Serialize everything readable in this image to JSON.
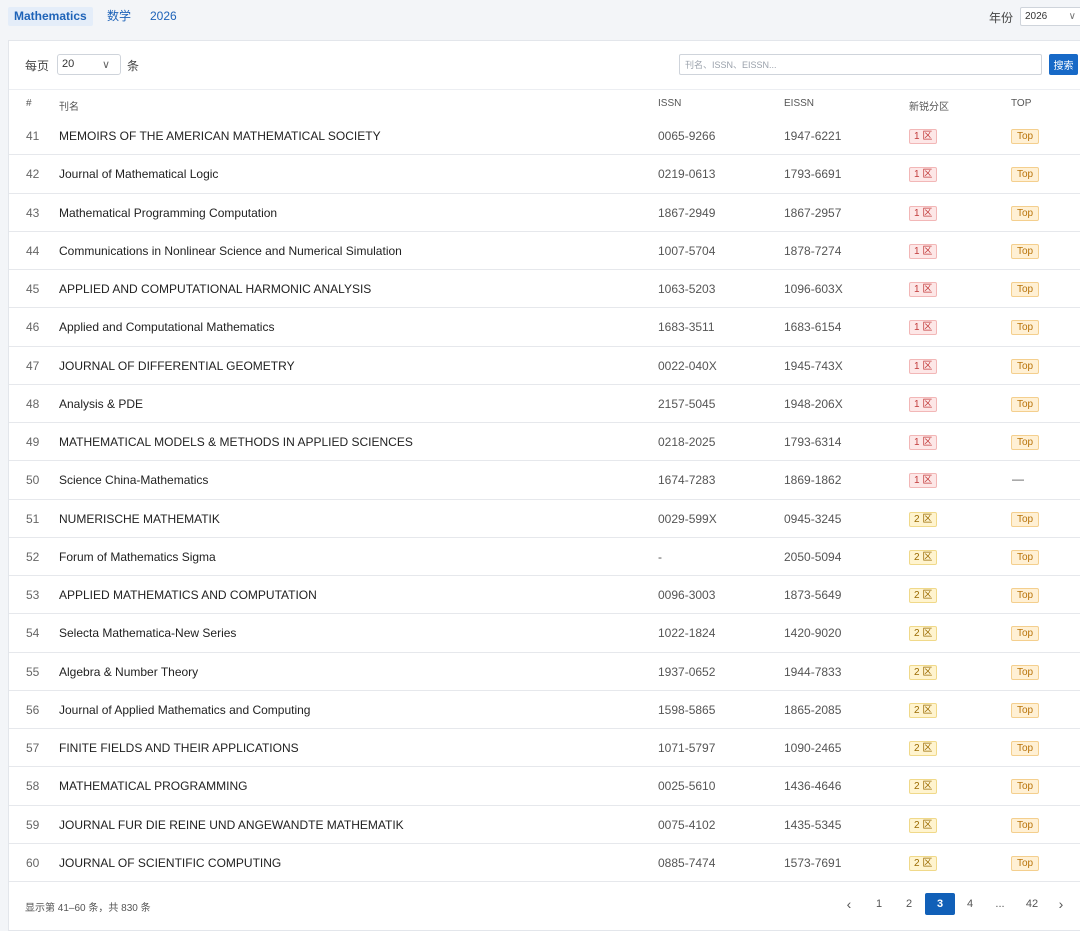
{
  "header": {
    "chips": [
      "Mathematics",
      "数学",
      "2026"
    ],
    "year_label": "年份",
    "year_value": "2026"
  },
  "toolbar": {
    "perpage_label": "每页",
    "perpage_value": "20",
    "perpage_unit": "条",
    "search_placeholder": "刊名、ISSN、EISSN...",
    "search_button": "搜索"
  },
  "table": {
    "columns": [
      "#",
      "刊名",
      "ISSN",
      "EISSN",
      "新锐分区",
      "TOP"
    ],
    "rows": [
      {
        "num": "41",
        "title": "MEMOIRS OF THE AMERICAN MATHEMATICAL SOCIETY",
        "issn": "0065-9266",
        "eissn": "1947-6221",
        "zone": "1 区",
        "zone_level": 1,
        "top": "Top"
      },
      {
        "num": "42",
        "title": "Journal of Mathematical Logic",
        "issn": "0219-0613",
        "eissn": "1793-6691",
        "zone": "1 区",
        "zone_level": 1,
        "top": "Top"
      },
      {
        "num": "43",
        "title": "Mathematical Programming Computation",
        "issn": "1867-2949",
        "eissn": "1867-2957",
        "zone": "1 区",
        "zone_level": 1,
        "top": "Top"
      },
      {
        "num": "44",
        "title": "Communications in Nonlinear Science and Numerical Simulation",
        "issn": "1007-5704",
        "eissn": "1878-7274",
        "zone": "1 区",
        "zone_level": 1,
        "top": "Top"
      },
      {
        "num": "45",
        "title": "APPLIED AND COMPUTATIONAL HARMONIC ANALYSIS",
        "issn": "1063-5203",
        "eissn": "1096-603X",
        "zone": "1 区",
        "zone_level": 1,
        "top": "Top"
      },
      {
        "num": "46",
        "title": "Applied and Computational Mathematics",
        "issn": "1683-3511",
        "eissn": "1683-6154",
        "zone": "1 区",
        "zone_level": 1,
        "top": "Top"
      },
      {
        "num": "47",
        "title": "JOURNAL OF DIFFERENTIAL GEOMETRY",
        "issn": "0022-040X",
        "eissn": "1945-743X",
        "zone": "1 区",
        "zone_level": 1,
        "top": "Top"
      },
      {
        "num": "48",
        "title": "Analysis & PDE",
        "issn": "2157-5045",
        "eissn": "1948-206X",
        "zone": "1 区",
        "zone_level": 1,
        "top": "Top"
      },
      {
        "num": "49",
        "title": "MATHEMATICAL MODELS & METHODS IN APPLIED SCIENCES",
        "issn": "0218-2025",
        "eissn": "1793-6314",
        "zone": "1 区",
        "zone_level": 1,
        "top": "Top"
      },
      {
        "num": "50",
        "title": "Science China-Mathematics",
        "issn": "1674-7283",
        "eissn": "1869-1862",
        "zone": "1 区",
        "zone_level": 1,
        "top": "—"
      },
      {
        "num": "51",
        "title": "NUMERISCHE MATHEMATIK",
        "issn": "0029-599X",
        "eissn": "0945-3245",
        "zone": "2 区",
        "zone_level": 2,
        "top": "Top"
      },
      {
        "num": "52",
        "title": "Forum of Mathematics Sigma",
        "issn": "-",
        "eissn": "2050-5094",
        "zone": "2 区",
        "zone_level": 2,
        "top": "Top"
      },
      {
        "num": "53",
        "title": "APPLIED MATHEMATICS AND COMPUTATION",
        "issn": "0096-3003",
        "eissn": "1873-5649",
        "zone": "2 区",
        "zone_level": 2,
        "top": "Top"
      },
      {
        "num": "54",
        "title": "Selecta Mathematica-New Series",
        "issn": "1022-1824",
        "eissn": "1420-9020",
        "zone": "2 区",
        "zone_level": 2,
        "top": "Top"
      },
      {
        "num": "55",
        "title": "Algebra & Number Theory",
        "issn": "1937-0652",
        "eissn": "1944-7833",
        "zone": "2 区",
        "zone_level": 2,
        "top": "Top"
      },
      {
        "num": "56",
        "title": "Journal of Applied Mathematics and Computing",
        "issn": "1598-5865",
        "eissn": "1865-2085",
        "zone": "2 区",
        "zone_level": 2,
        "top": "Top"
      },
      {
        "num": "57",
        "title": "FINITE FIELDS AND THEIR APPLICATIONS",
        "issn": "1071-5797",
        "eissn": "1090-2465",
        "zone": "2 区",
        "zone_level": 2,
        "top": "Top"
      },
      {
        "num": "58",
        "title": "MATHEMATICAL PROGRAMMING",
        "issn": "0025-5610",
        "eissn": "1436-4646",
        "zone": "2 区",
        "zone_level": 2,
        "top": "Top"
      },
      {
        "num": "59",
        "title": "JOURNAL FUR DIE REINE UND ANGEWANDTE MATHEMATIK",
        "issn": "0075-4102",
        "eissn": "1435-5345",
        "zone": "2 区",
        "zone_level": 2,
        "top": "Top"
      },
      {
        "num": "60",
        "title": "JOURNAL OF SCIENTIFIC COMPUTING",
        "issn": "0885-7474",
        "eissn": "1573-7691",
        "zone": "2 区",
        "zone_level": 2,
        "top": "Top"
      }
    ]
  },
  "footer": {
    "info": "显示第 41–60 条，共 830 条",
    "pagination": {
      "prev": "‹",
      "pages": [
        "1",
        "2",
        "3",
        "4",
        "...",
        "42"
      ],
      "current": "3",
      "next": "›"
    }
  },
  "colors": {
    "accent": "#1769c7",
    "zone1_text": "#c23b3b",
    "zone2_text": "#9a6a00",
    "top_text": "#b8730a"
  }
}
